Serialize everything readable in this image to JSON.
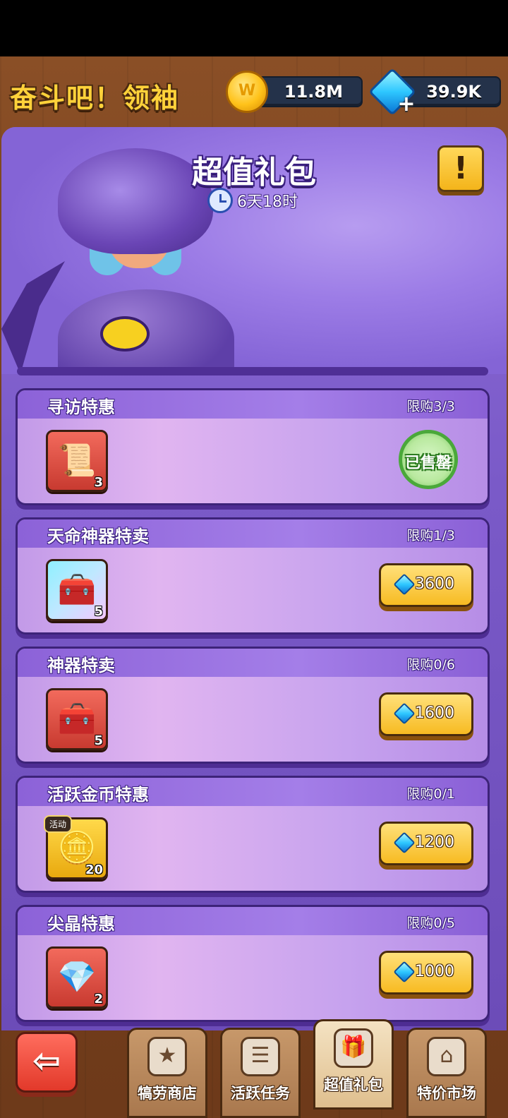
{
  "header": {
    "game_title": "奋斗吧！领袖",
    "coins": "11.8M",
    "gems": "39.9K"
  },
  "panel": {
    "title": "超值礼包",
    "timer": "6天18时",
    "info_label": "!"
  },
  "offers": [
    {
      "title": "寻访特惠",
      "limit": "限购3/3",
      "item_count": "3",
      "item_icon": "scroll-icon",
      "status": "已售罄",
      "price": ""
    },
    {
      "title": "天命神器特卖",
      "limit": "限购1/3",
      "item_count": "5",
      "item_icon": "treasure-chest-icon",
      "status": "",
      "price": "3600"
    },
    {
      "title": "神器特卖",
      "limit": "限购0/6",
      "item_count": "5",
      "item_icon": "treasure-chest-icon",
      "status": "",
      "price": "1600"
    },
    {
      "title": "活跃金币特惠",
      "limit": "限购0/1",
      "item_count": "20",
      "item_icon": "gold-coin-icon",
      "item_tag": "活动",
      "status": "",
      "price": "1200"
    },
    {
      "title": "尖晶特惠",
      "limit": "限购0/5",
      "item_count": "2",
      "item_icon": "spinel-crystal-icon",
      "status": "",
      "price": "1000"
    }
  ],
  "nav": {
    "back": "⇦",
    "tabs": [
      {
        "label": "犒劳商店",
        "icon": "shop-badge-icon"
      },
      {
        "label": "活跃任务",
        "icon": "task-list-icon"
      },
      {
        "label": "超值礼包",
        "icon": "gift-box-icon"
      },
      {
        "label": "特价市场",
        "icon": "market-stall-icon"
      }
    ]
  },
  "colors": {
    "panel_purple": "#7a5ac8",
    "button_gold": "#f7bb22",
    "gem_blue": "#2ec7ff"
  }
}
